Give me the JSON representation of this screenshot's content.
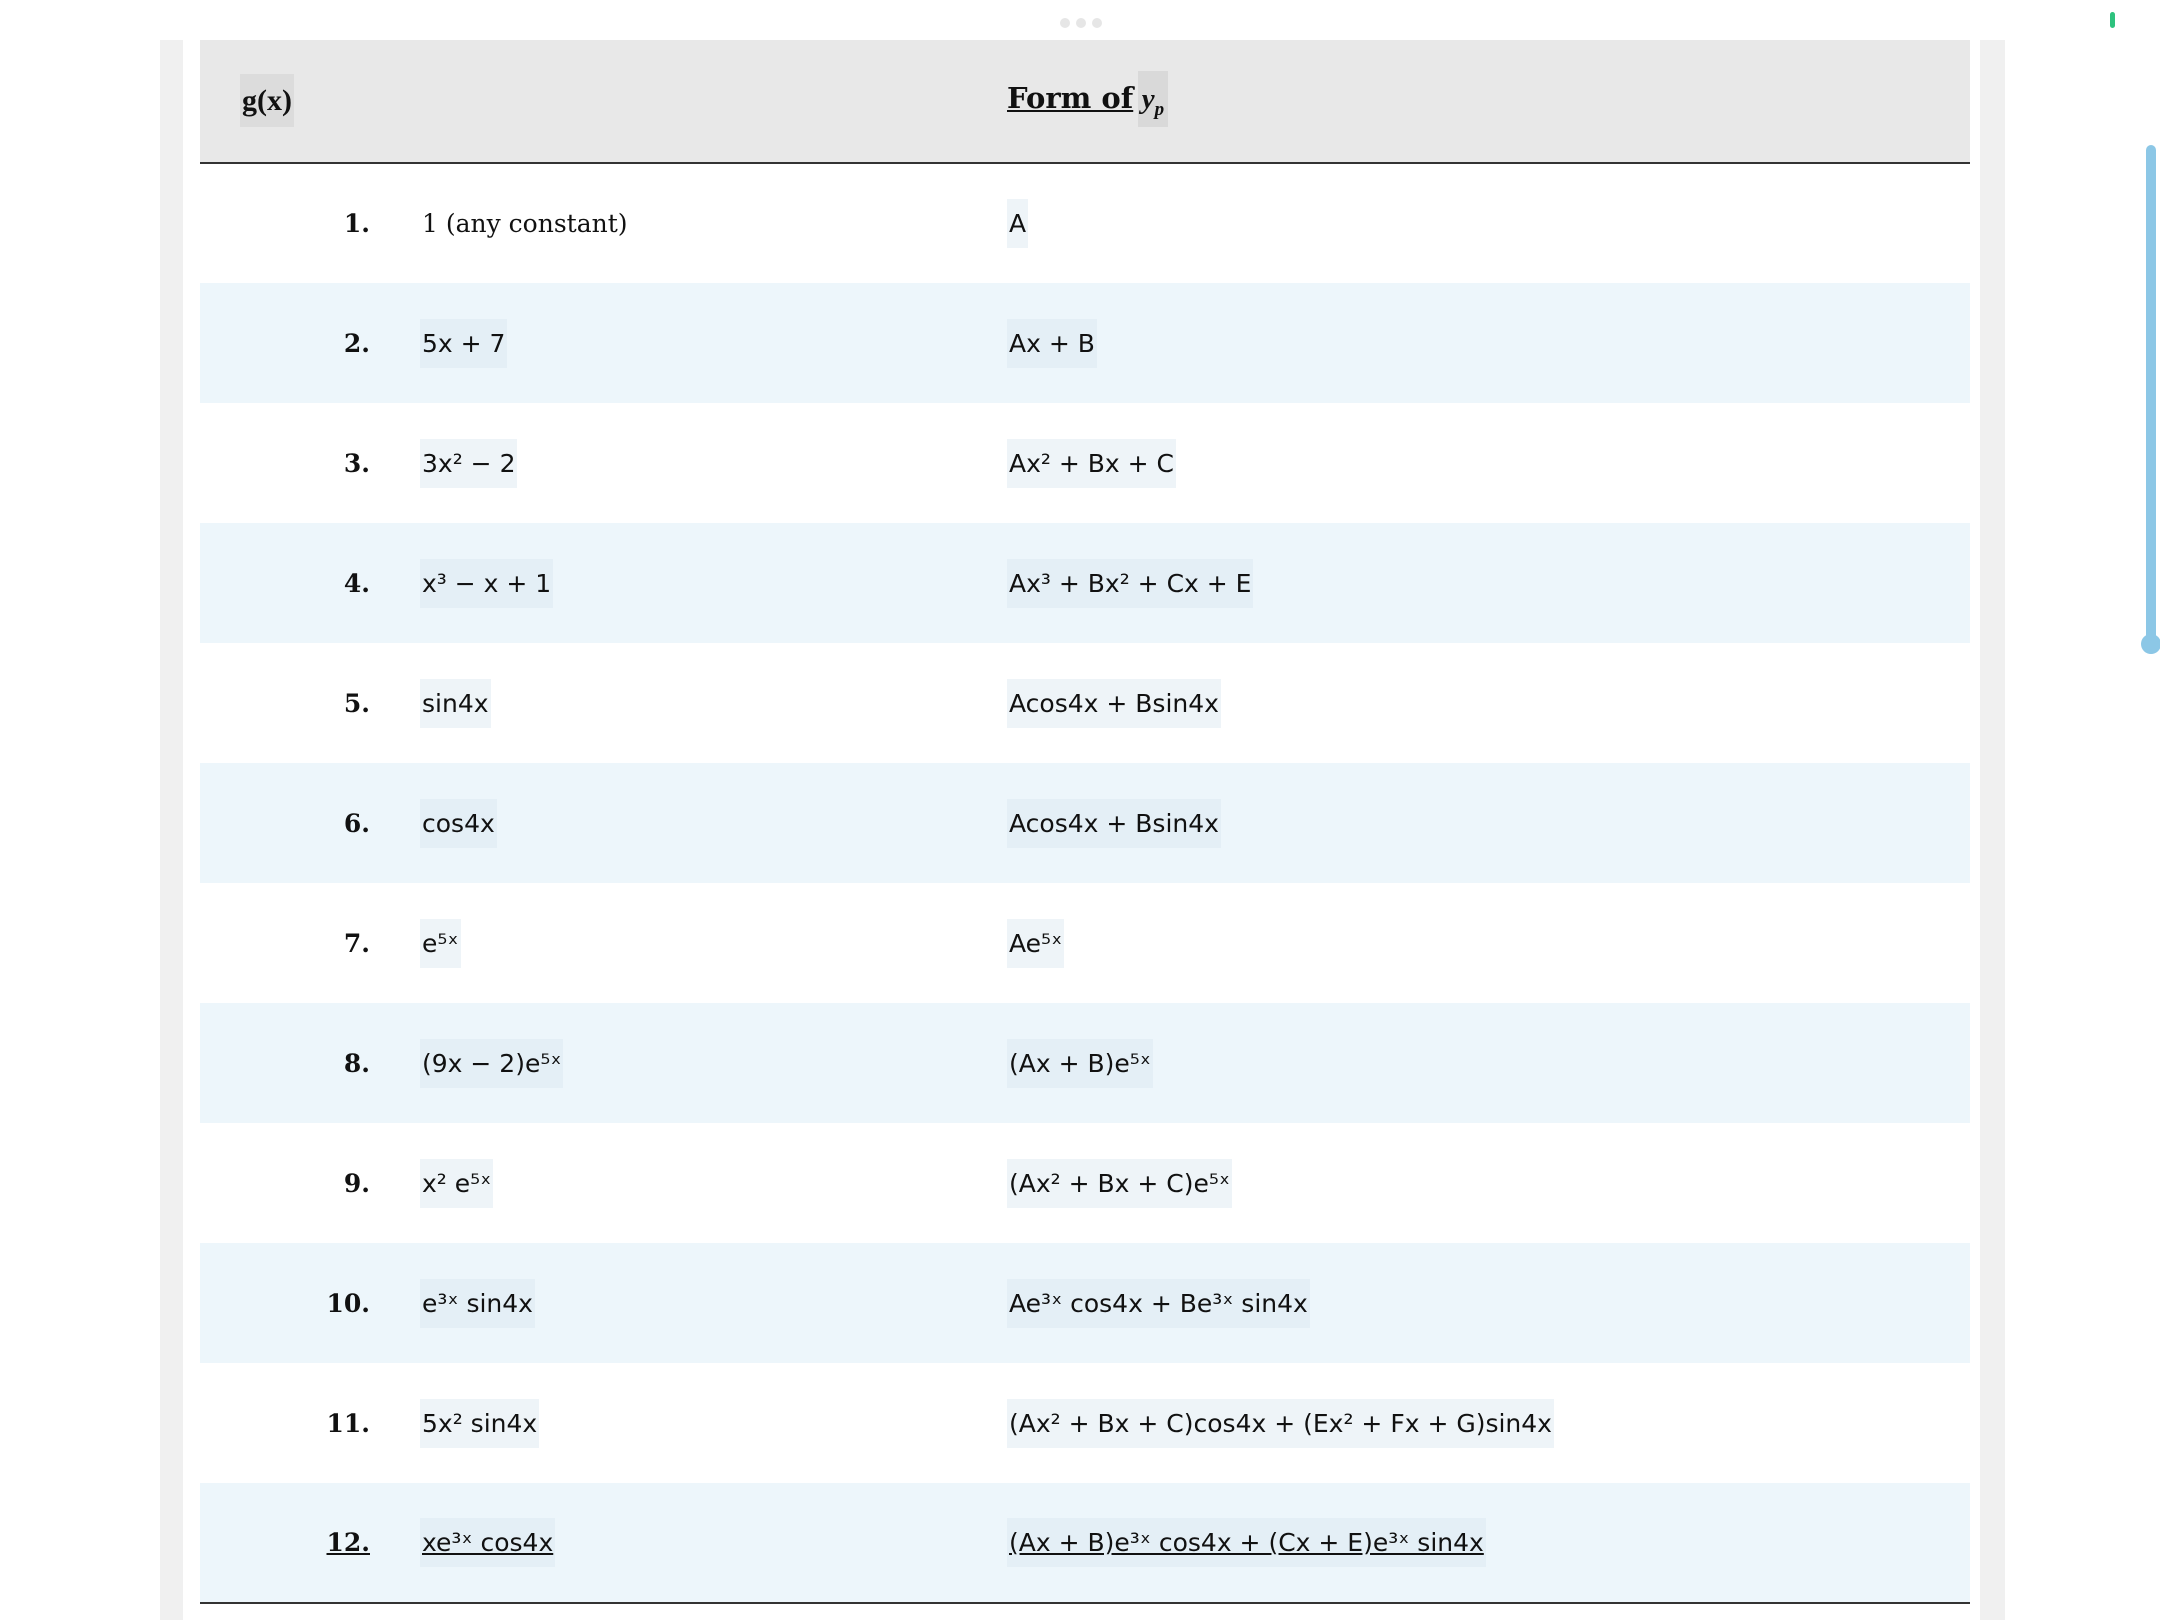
{
  "header": {
    "gx_label": "g(x)",
    "form_label": "Form of",
    "form_symbol": "y",
    "form_sub": "p"
  },
  "rows": [
    {
      "n": "1.",
      "g": "1 (any constant)",
      "f": "A"
    },
    {
      "n": "2.",
      "g": "5x + 7",
      "f": "Ax + B"
    },
    {
      "n": "3.",
      "g": "3x² − 2",
      "f": "Ax² + Bx + C"
    },
    {
      "n": "4.",
      "g": "x³ − x + 1",
      "f": "Ax³ + Bx² + Cx + E"
    },
    {
      "n": "5.",
      "g": "sin4x",
      "f": "Acos4x + Bsin4x"
    },
    {
      "n": "6.",
      "g": "cos4x",
      "f": "Acos4x + Bsin4x"
    },
    {
      "n": "7.",
      "g": "e⁵ˣ",
      "f": "Ae⁵ˣ"
    },
    {
      "n": "8.",
      "g": "(9x − 2)e⁵ˣ",
      "f": "(Ax + B)e⁵ˣ"
    },
    {
      "n": "9.",
      "g": "x² e⁵ˣ",
      "f": "(Ax² + Bx + C)e⁵ˣ"
    },
    {
      "n": "10.",
      "g": "e³ˣ sin4x",
      "f": "Ae³ˣ cos4x + Be³ˣ sin4x"
    },
    {
      "n": "11.",
      "g": "5x² sin4x",
      "f": "(Ax² + Bx + C)cos4x + (Ex² + Fx + G)sin4x"
    },
    {
      "n": "12.",
      "g": "xe³ˣ cos4x",
      "f": "(Ax + B)e³ˣ cos4x + (Cx + E)e³ˣ sin4x"
    }
  ]
}
